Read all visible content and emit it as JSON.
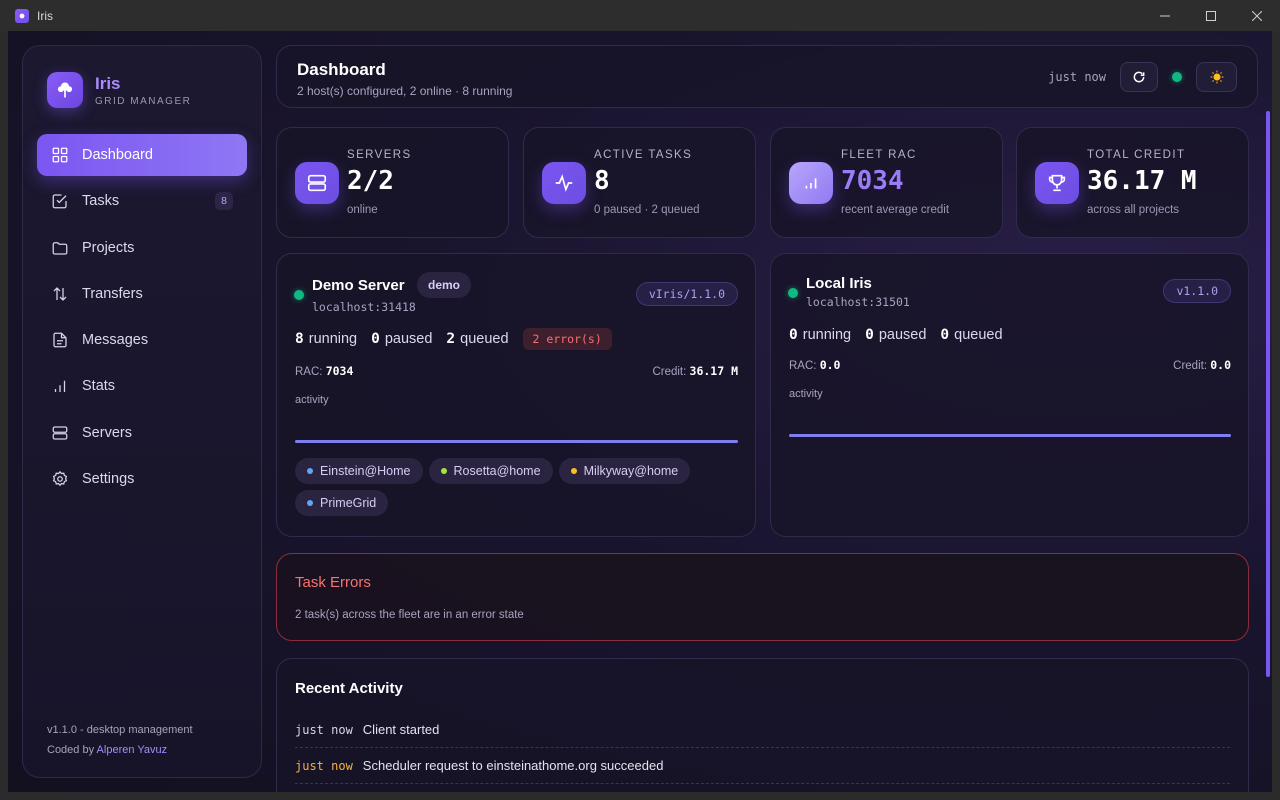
{
  "window": {
    "title": "Iris"
  },
  "brand": {
    "name": "Iris",
    "subtitle": "GRID MANAGER"
  },
  "sidebar": {
    "items": [
      {
        "label": "Dashboard",
        "icon": "grid-icon",
        "active": true
      },
      {
        "label": "Tasks",
        "icon": "checkbox-icon",
        "badge": "8"
      },
      {
        "label": "Projects",
        "icon": "folder-icon"
      },
      {
        "label": "Transfers",
        "icon": "transfer-icon"
      },
      {
        "label": "Messages",
        "icon": "document-icon"
      },
      {
        "label": "Stats",
        "icon": "bar-chart-icon"
      },
      {
        "label": "Servers",
        "icon": "server-icon"
      },
      {
        "label": "Settings",
        "icon": "gear-icon"
      }
    ],
    "footer": {
      "version": "v1.1.0 - desktop management",
      "coded_by": "Coded by",
      "author": "Alperen Yavuz"
    }
  },
  "header": {
    "title": "Dashboard",
    "subtitle": "2 host(s) configured, 2 online · 8 running",
    "updated": "just now"
  },
  "stats": [
    {
      "label": "SERVERS",
      "value": "2/2",
      "sub": "online",
      "icon": "server-icon"
    },
    {
      "label": "ACTIVE TASKS",
      "value": "8",
      "sub": "0 paused · 2 queued",
      "icon": "activity-icon"
    },
    {
      "label": "FLEET RAC",
      "value": "7034",
      "sub": "recent average credit",
      "icon": "bar-chart-icon"
    },
    {
      "label": "TOTAL CREDIT",
      "value": "36.17 M",
      "sub": "across all projects",
      "icon": "trophy-icon"
    }
  ],
  "servers": [
    {
      "name": "Demo Server",
      "tag": "demo",
      "host": "localhost:31418",
      "version": "vIris/1.1.0",
      "running": "8",
      "running_label": "running",
      "paused": "0",
      "paused_label": "paused",
      "queued": "2",
      "queued_label": "queued",
      "errors": "2 error(s)",
      "rac_label": "RAC:",
      "rac": "7034",
      "credit_label": "Credit:",
      "credit": "36.17 M",
      "activity_label": "activity",
      "projects": [
        {
          "name": "Einstein@Home",
          "color": "#60a5fa"
        },
        {
          "name": "Rosetta@home",
          "color": "#a3e635"
        },
        {
          "name": "Milkyway@home",
          "color": "#fbbf24"
        },
        {
          "name": "PrimeGrid",
          "color": "#60a5fa"
        }
      ]
    },
    {
      "name": "Local Iris",
      "host": "localhost:31501",
      "version": "v1.1.0",
      "running": "0",
      "running_label": "running",
      "paused": "0",
      "paused_label": "paused",
      "queued": "0",
      "queued_label": "queued",
      "rac_label": "RAC:",
      "rac": "0.0",
      "credit_label": "Credit:",
      "credit": "0.0",
      "activity_label": "activity"
    }
  ],
  "task_errors": {
    "title": "Task Errors",
    "description": "2 task(s) across the fleet are in an error state"
  },
  "recent_activity": {
    "title": "Recent Activity",
    "rows": [
      {
        "time": "just now",
        "text": "Client started"
      },
      {
        "time": "just now",
        "text": "Scheduler request to einsteinathome.org succeeded"
      }
    ]
  },
  "colors": {
    "accent": "#7b56f2",
    "online": "#10b981",
    "error": "#f87171",
    "warning": "#f5b342"
  }
}
